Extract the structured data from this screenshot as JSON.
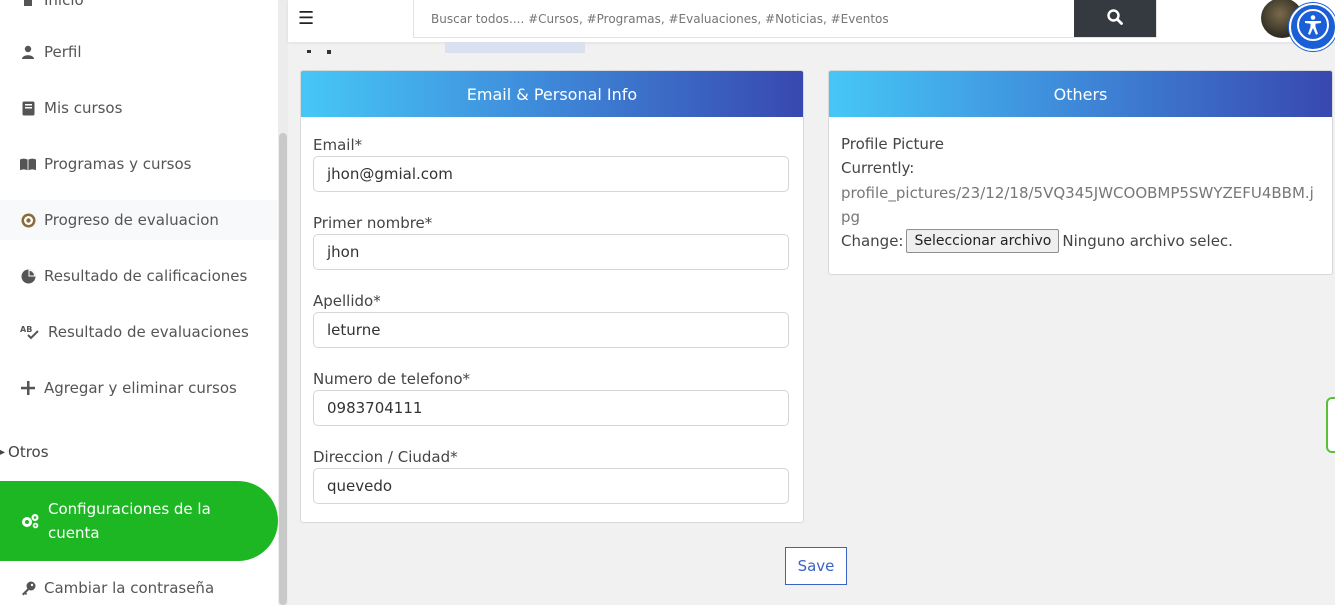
{
  "sidebar": {
    "items": [
      {
        "label": "Inicio",
        "icon": "home-icon"
      },
      {
        "label": "Perfil",
        "icon": "user-icon"
      },
      {
        "label": "Mis cursos",
        "icon": "book-icon"
      },
      {
        "label": "Programas y cursos",
        "icon": "open-book-icon"
      },
      {
        "label": "Progreso de evaluacion",
        "icon": "bullseye-icon"
      },
      {
        "label": "Resultado de calificaciones",
        "icon": "pie-chart-icon"
      },
      {
        "label": "Resultado de evaluaciones",
        "icon": "spell-check-icon"
      },
      {
        "label": "Agregar y eliminar cursos",
        "icon": "plus-icon"
      }
    ],
    "section_label": "Otros",
    "section_items": [
      {
        "label": "Configuraciones de la cuenta",
        "icon": "cogs-icon"
      },
      {
        "label": "Cambiar la contraseña",
        "icon": "key-icon"
      }
    ]
  },
  "header": {
    "search_placeholder": "Buscar todos.... #Cursos, #Programas, #Evaluaciones, #Noticias, #Eventos"
  },
  "personal_card": {
    "title": "Email & Personal Info",
    "fields": [
      {
        "label": "Email*",
        "value": "jhon@gmial.com"
      },
      {
        "label": "Primer nombre*",
        "value": "jhon"
      },
      {
        "label": "Apellido*",
        "value": "leturne"
      },
      {
        "label": "Numero de telefono*",
        "value": "0983704111"
      },
      {
        "label": "Direccion / Ciudad*",
        "value": "quevedo"
      }
    ]
  },
  "others_card": {
    "title": "Others",
    "picture_label": "Profile Picture",
    "currently_label": "Currently:",
    "current_path": "profile_pictures/23/12/18/5VQ345JWCOOBMP5SWYZEFU4BBM.jpg",
    "change_label": "Change:",
    "file_button_label": "Seleccionar archivo",
    "file_status": "Ninguno archivo selec."
  },
  "save_label": "Save",
  "colors": {
    "active_green": "#1db723",
    "header_gradient_start": "#46c7f7",
    "header_gradient_end": "#3848b0",
    "save_blue": "#3b63c4",
    "search_button": "#343a40",
    "accessibility_blue": "#1a5fd6"
  }
}
